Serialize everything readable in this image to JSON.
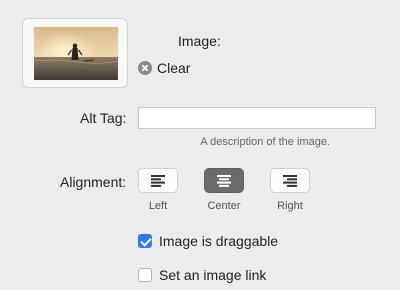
{
  "image_section": {
    "label": "Image:",
    "thumbnail_icon": "photo-thumbnail",
    "clear_label": "Clear",
    "clear_icon": "clear-circle-x-icon"
  },
  "alt_tag": {
    "label": "Alt Tag:",
    "value": "",
    "placeholder": "",
    "help_text": "A description of the image."
  },
  "alignment": {
    "label": "Alignment:",
    "options": [
      {
        "label": "Left",
        "icon": "align-left-icon",
        "selected": false
      },
      {
        "label": "Center",
        "icon": "align-center-icon",
        "selected": true
      },
      {
        "label": "Right",
        "icon": "align-right-icon",
        "selected": false
      }
    ]
  },
  "options": {
    "draggable": {
      "label": "Image is draggable",
      "checked": true
    },
    "image_link": {
      "label": "Set an image link",
      "checked": false
    }
  },
  "colors": {
    "accent": "#2f7bf5",
    "selected_button": "#6b6b6b",
    "background": "#ececec"
  }
}
